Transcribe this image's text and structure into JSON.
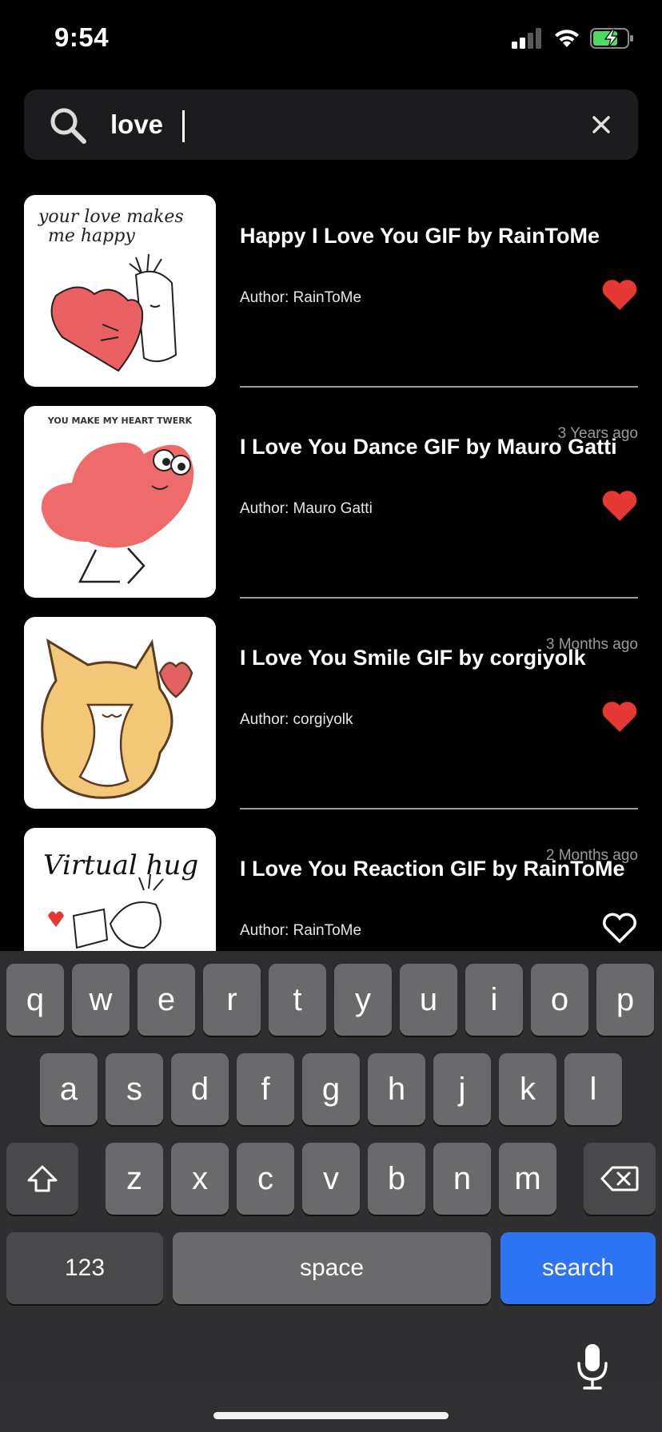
{
  "status_bar": {
    "time": "9:54",
    "signal_icon": "cellular-signal-icon",
    "wifi_icon": "wifi-icon",
    "battery_icon": "battery-charging-icon"
  },
  "search": {
    "value": "love",
    "search_icon": "search-icon",
    "clear_icon": "close-icon"
  },
  "results": [
    {
      "ago": "",
      "title": "Happy I Love You GIF by RainToMe",
      "author": "Author: RainToMe",
      "favorited": true,
      "thumb_text": [
        "your love makes",
        "me happy"
      ]
    },
    {
      "ago": "3  Years ago",
      "title": "I Love You Dance GIF by Mauro Gatti",
      "author": "Author: Mauro Gatti",
      "favorited": true,
      "thumb_text": [
        "YOU MAKE MY HEART TWERK"
      ]
    },
    {
      "ago": "3  Months ago",
      "title": "I Love You Smile GIF by corgiyolk",
      "author": "Author: corgiyolk",
      "favorited": true,
      "thumb_text": []
    },
    {
      "ago": "2  Months ago",
      "title": "I Love You Reaction GIF by RainToMe",
      "author": "Author: RainToMe",
      "favorited": false,
      "thumb_text": [
        "Virtual hug"
      ]
    }
  ],
  "keyboard": {
    "row1": [
      "q",
      "w",
      "e",
      "r",
      "t",
      "y",
      "u",
      "i",
      "o",
      "p"
    ],
    "row2": [
      "a",
      "s",
      "d",
      "f",
      "g",
      "h",
      "j",
      "k",
      "l"
    ],
    "row3": [
      "z",
      "x",
      "c",
      "v",
      "b",
      "n",
      "m"
    ],
    "shift_icon": "shift-icon",
    "backspace_icon": "backspace-icon",
    "numbers_label": "123",
    "space_label": "space",
    "search_label": "search",
    "mic_icon": "microphone-icon"
  },
  "colors": {
    "accent": "#2f73f5",
    "heart": "#e53935",
    "background": "#000000"
  }
}
